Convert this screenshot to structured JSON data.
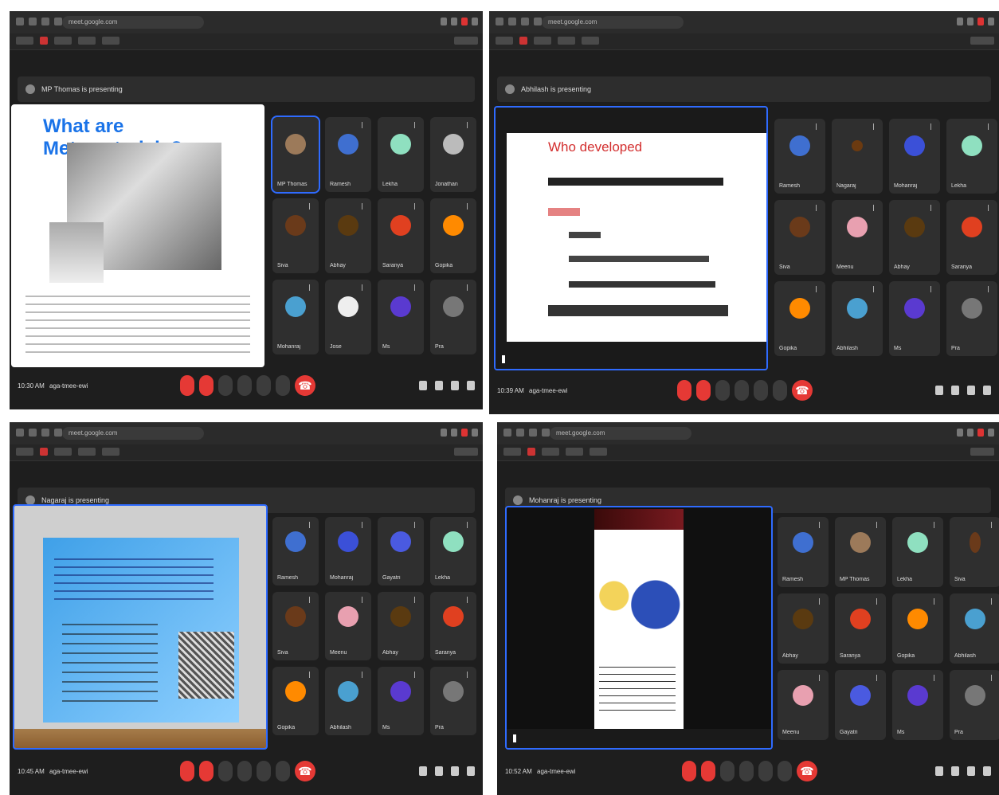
{
  "windows": [
    {
      "url": "meet.google.com",
      "presenter_label": "MP Thomas is presenting",
      "slide": {
        "title": "What are Metamaterials?"
      },
      "tiles": [
        "MP Thomas",
        "Ramesh",
        "Lekha",
        "Jonathan",
        "Siva",
        "Abhay",
        "Saranya",
        "Gopika",
        "Mohanraj",
        "Jose",
        "Ms",
        "Pra"
      ],
      "time": "10:30 AM",
      "meeting_code": "aga-tmee-ewi"
    },
    {
      "url": "meet.google.com",
      "presenter_label": "Abhilash is presenting",
      "slide": {
        "title": "Who developed"
      },
      "tiles": [
        "Ramesh",
        "Nagaraj",
        "Mohanraj",
        "Lekha",
        "Siva",
        "Meenu",
        "Abhay",
        "Saranya",
        "Gopika",
        "Abhilash",
        "Ms",
        "Pra"
      ],
      "time": "10:39 AM",
      "meeting_code": "aga-tmee-ewi"
    },
    {
      "url": "meet.google.com",
      "presenter_label": "Nagaraj is presenting",
      "tiles": [
        "Ramesh",
        "Mohanraj",
        "Gayatri",
        "Lekha",
        "Siva",
        "Meenu",
        "Abhay",
        "Saranya",
        "Gopika",
        "Abhilash",
        "Ms",
        "Pra"
      ],
      "time": "10:45 AM",
      "meeting_code": "aga-tmee-ewi"
    },
    {
      "url": "meet.google.com",
      "presenter_label": "Mohanraj is presenting",
      "tiles": [
        "Ramesh",
        "MP Thomas",
        "Lekha",
        "Siva",
        "Abhay",
        "Saranya",
        "Gopika",
        "Abhilash",
        "Meenu",
        "Gayatri",
        "Ms",
        "Pra"
      ],
      "time": "10:52 AM",
      "meeting_code": "aga-tmee-ewi"
    }
  ],
  "colors": {
    "accent": "#2f6bff",
    "danger": "#e53935"
  }
}
